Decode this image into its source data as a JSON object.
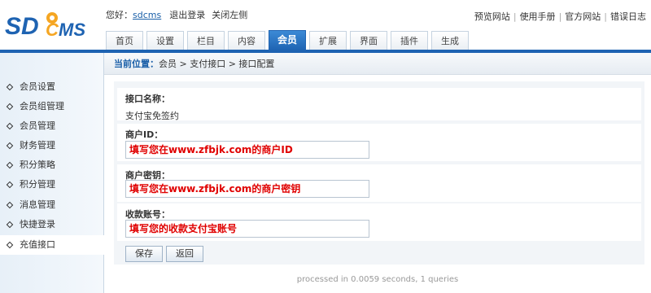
{
  "brand": {
    "logo_text": "SDCMS"
  },
  "user": {
    "greeting": "您好：",
    "name": "sdcms",
    "logout": "退出登录",
    "close_left": "关闭左侧"
  },
  "top_links": [
    "预览网站",
    "使用手册",
    "官方网站",
    "错误日志"
  ],
  "tabs": [
    "首页",
    "设置",
    "栏目",
    "内容",
    "会员",
    "扩展",
    "界面",
    "插件",
    "生成"
  ],
  "active_tab": "会员",
  "sidebar": {
    "items": [
      "会员设置",
      "会员组管理",
      "会员管理",
      "财务管理",
      "积分策略",
      "积分管理",
      "消息管理",
      "快捷登录",
      "充值接口"
    ],
    "active": "充值接口"
  },
  "breadcrumb": {
    "lead": "当前位置：",
    "path": "会员 > 支付接口 > 接口配置"
  },
  "form": {
    "name_label": "接口名称：",
    "name_value": "支付宝免签约",
    "merchant_id_label": "商户ID：",
    "merchant_id_value": "填写您在www.zfbjk.com的商户ID",
    "merchant_key_label": "商户密钥：",
    "merchant_key_value": "填写您在www.zfbjk.com的商户密钥",
    "account_label": "收款账号：",
    "account_value": "填写您的收款支付宝账号",
    "save_label": "保存",
    "back_label": "返回"
  },
  "footer": "processed in 0.0059 seconds, 1 queries",
  "colors": {
    "accent": "#1e63b2",
    "input_text": "#e00000",
    "link": "#1a5fa8"
  }
}
